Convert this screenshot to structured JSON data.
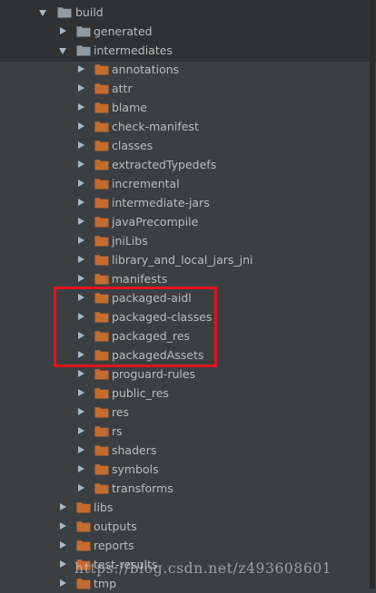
{
  "colors": {
    "background": "#3c3f41",
    "top_band": "#2f3133",
    "text": "#bbbbbb",
    "folder_generic": "#8e9aa4",
    "folder_excluded": "#c46b2e",
    "highlight": "#e0151d"
  },
  "tree": [
    {
      "label": "build",
      "level": 0,
      "state": "expanded",
      "icon": "folder-icon"
    },
    {
      "label": "generated",
      "level": 1,
      "state": "collapsed",
      "icon": "folder-icon"
    },
    {
      "label": "intermediates",
      "level": 1,
      "state": "expanded",
      "icon": "folder-icon"
    },
    {
      "label": "annotations",
      "level": 2,
      "state": "collapsed",
      "icon": "excluded-folder-icon"
    },
    {
      "label": "attr",
      "level": 2,
      "state": "collapsed",
      "icon": "excluded-folder-icon"
    },
    {
      "label": "blame",
      "level": 2,
      "state": "collapsed",
      "icon": "excluded-folder-icon"
    },
    {
      "label": "check-manifest",
      "level": 2,
      "state": "collapsed",
      "icon": "excluded-folder-icon"
    },
    {
      "label": "classes",
      "level": 2,
      "state": "collapsed",
      "icon": "excluded-folder-icon"
    },
    {
      "label": "extractedTypedefs",
      "level": 2,
      "state": "collapsed",
      "icon": "excluded-folder-icon"
    },
    {
      "label": "incremental",
      "level": 2,
      "state": "collapsed",
      "icon": "excluded-folder-icon"
    },
    {
      "label": "intermediate-jars",
      "level": 2,
      "state": "collapsed",
      "icon": "excluded-folder-icon"
    },
    {
      "label": "javaPrecompile",
      "level": 2,
      "state": "collapsed",
      "icon": "excluded-folder-icon"
    },
    {
      "label": "jniLibs",
      "level": 2,
      "state": "collapsed",
      "icon": "excluded-folder-icon"
    },
    {
      "label": "library_and_local_jars_jni",
      "level": 2,
      "state": "collapsed",
      "icon": "excluded-folder-icon"
    },
    {
      "label": "manifests",
      "level": 2,
      "state": "collapsed",
      "icon": "excluded-folder-icon"
    },
    {
      "label": "packaged-aidl",
      "level": 2,
      "state": "collapsed",
      "icon": "excluded-folder-icon"
    },
    {
      "label": "packaged-classes",
      "level": 2,
      "state": "collapsed",
      "icon": "excluded-folder-icon"
    },
    {
      "label": "packaged_res",
      "level": 2,
      "state": "collapsed",
      "icon": "excluded-folder-icon"
    },
    {
      "label": "packagedAssets",
      "level": 2,
      "state": "collapsed",
      "icon": "excluded-folder-icon"
    },
    {
      "label": "proguard-rules",
      "level": 2,
      "state": "collapsed",
      "icon": "excluded-folder-icon"
    },
    {
      "label": "public_res",
      "level": 2,
      "state": "collapsed",
      "icon": "excluded-folder-icon"
    },
    {
      "label": "res",
      "level": 2,
      "state": "collapsed",
      "icon": "excluded-folder-icon"
    },
    {
      "label": "rs",
      "level": 2,
      "state": "collapsed",
      "icon": "excluded-folder-icon"
    },
    {
      "label": "shaders",
      "level": 2,
      "state": "collapsed",
      "icon": "excluded-folder-icon"
    },
    {
      "label": "symbols",
      "level": 2,
      "state": "collapsed",
      "icon": "excluded-folder-icon"
    },
    {
      "label": "transforms",
      "level": 2,
      "state": "collapsed",
      "icon": "excluded-folder-icon"
    },
    {
      "label": "libs",
      "level": 1,
      "state": "collapsed",
      "icon": "excluded-folder-icon"
    },
    {
      "label": "outputs",
      "level": 1,
      "state": "collapsed",
      "icon": "excluded-folder-icon"
    },
    {
      "label": "reports",
      "level": 1,
      "state": "collapsed",
      "icon": "excluded-folder-icon"
    },
    {
      "label": "test-results",
      "level": 1,
      "state": "collapsed",
      "icon": "excluded-folder-icon"
    },
    {
      "label": "tmp",
      "level": 1,
      "state": "collapsed",
      "icon": "excluded-folder-icon"
    }
  ],
  "watermark": "https://blog.csdn.net/z493608601"
}
